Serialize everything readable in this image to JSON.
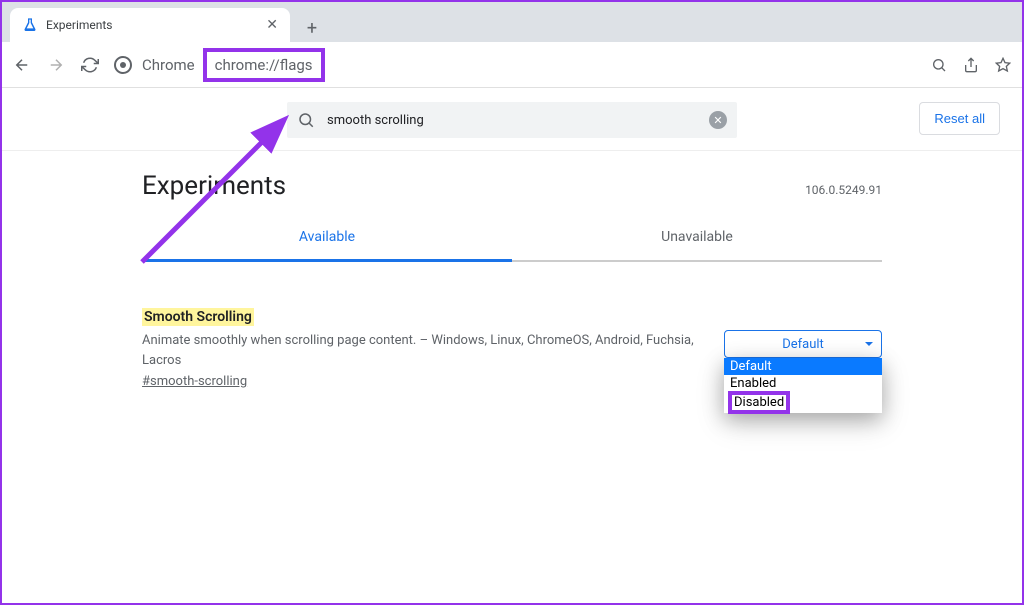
{
  "tab": {
    "title": "Experiments"
  },
  "toolbar": {
    "addr_label": "Chrome",
    "url": "chrome://flags"
  },
  "search": {
    "value": "smooth scrolling"
  },
  "reset_label": "Reset all",
  "heading": "Experiments",
  "version": "106.0.5249.91",
  "tabs": {
    "available": "Available",
    "unavailable": "Unavailable"
  },
  "flag": {
    "title": "Smooth Scrolling",
    "description": "Animate smoothly when scrolling page content. – Windows, Linux, ChromeOS, Android, Fuchsia, Lacros",
    "hash": "#smooth-scrolling",
    "selected": "Default",
    "options": [
      "Default",
      "Enabled",
      "Disabled"
    ]
  }
}
